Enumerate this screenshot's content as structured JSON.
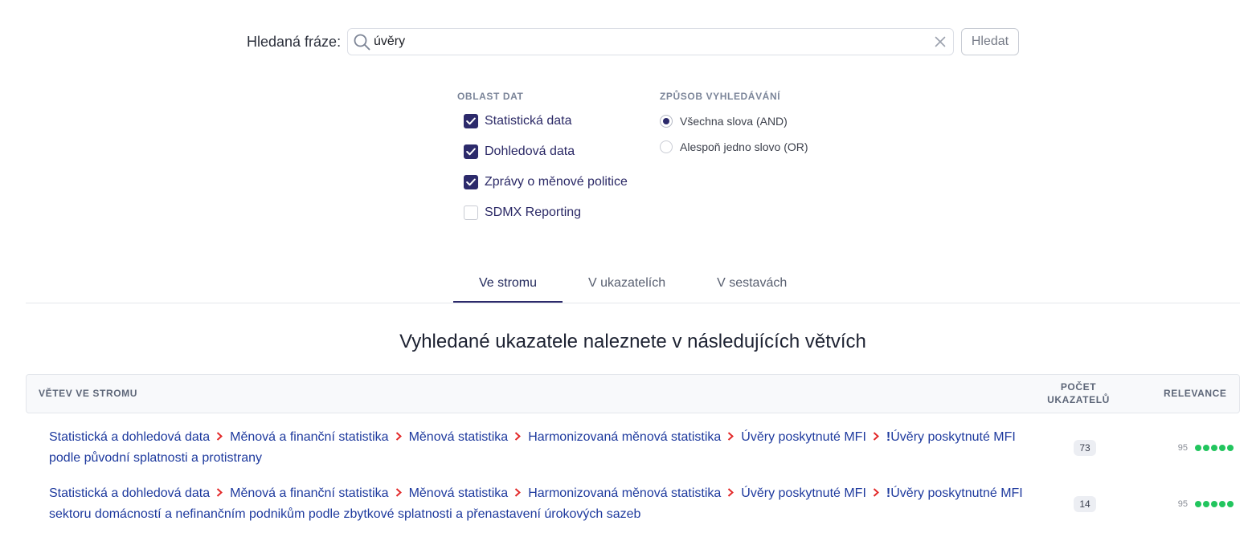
{
  "search": {
    "label": "Hledaná fráze:",
    "query": "úvěry",
    "button_label": "Hledat",
    "icons": {
      "search": "search-icon",
      "clear": "close-icon"
    }
  },
  "filters": {
    "data_area": {
      "title": "OBLAST DAT",
      "options": [
        {
          "label": "Statistická data",
          "checked": true
        },
        {
          "label": "Dohledová data",
          "checked": true
        },
        {
          "label": "Zprávy o měnové politice",
          "checked": true
        },
        {
          "label": "SDMX Reporting",
          "checked": false
        }
      ]
    },
    "search_mode": {
      "title": "ZPŮSOB VYHLEDÁVÁNÍ",
      "options": [
        {
          "label": "Všechna slova (AND)",
          "selected": true
        },
        {
          "label": "Alespoň jedno slovo (OR)",
          "selected": false
        }
      ]
    }
  },
  "tabs": [
    {
      "label": "Ve stromu",
      "active": true
    },
    {
      "label": "V ukazatelích",
      "active": false
    },
    {
      "label": "V sestavách",
      "active": false
    }
  ],
  "results": {
    "heading": "Vyhledané ukazatele naleznete v následujících větvích",
    "columns": {
      "branch": "VĚTEV VE STROMU",
      "count": "POČET UKAZATELŮ",
      "relevance": "RELEVANCE"
    },
    "rows": [
      {
        "path": [
          "Statistická a dohledová data",
          "Měnová a finanční statistika",
          "Měnová statistika",
          "Harmonizovaná měnová statistika",
          "Úvěry poskytnuté MFI"
        ],
        "leaf_marker": "!",
        "leaf": "Úvěry poskytnuté MFI podle původní splatnosti a protistrany",
        "count": "73",
        "relevance": "95",
        "relevance_dots": 5
      },
      {
        "path": [
          "Statistická a dohledová data",
          "Měnová a finanční statistika",
          "Měnová statistika",
          "Harmonizovaná měnová statistika",
          "Úvěry poskytnuté MFI"
        ],
        "leaf_marker": "!",
        "leaf": "Úvěry poskytnutné MFI sektoru domácností a nefinančním podnikům podle zbytkové splatnosti a přenastavení úrokových sazeb",
        "count": "14",
        "relevance": "95",
        "relevance_dots": 5
      }
    ],
    "icons": {
      "separator": "chevron-right-icon",
      "check": "checkmark-icon"
    }
  },
  "colors": {
    "link": "#1e3a9e",
    "breadcrumb_separator": "#e32a2a",
    "accent": "#2c2a6b",
    "relevance_dot": "#22c55e"
  }
}
